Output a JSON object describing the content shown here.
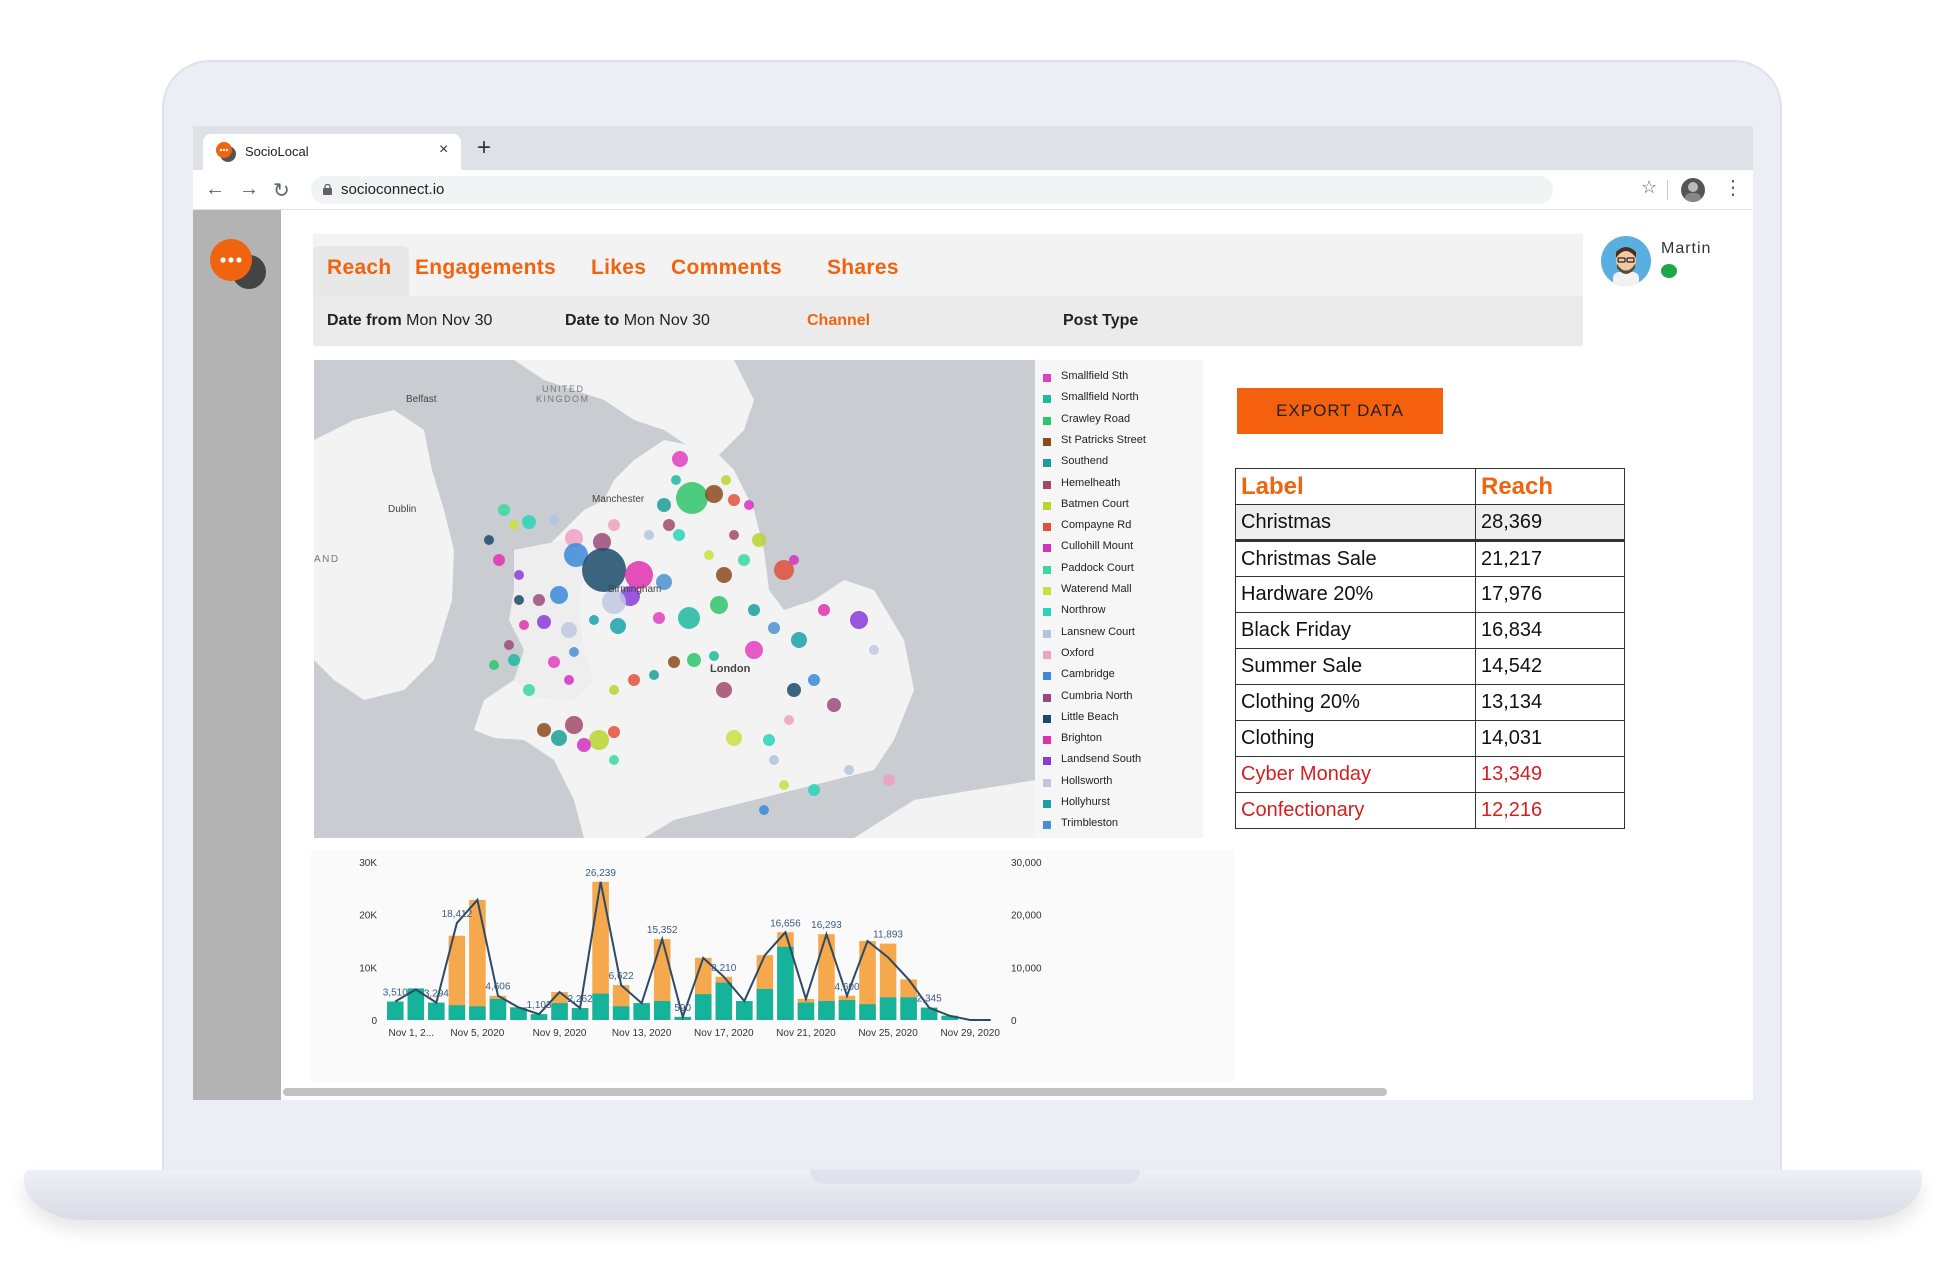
{
  "browser": {
    "tab_title": "SocioLocal",
    "tab_close": "×",
    "new_tab": "+",
    "url": "socioconnect.io",
    "nav_back": "←",
    "nav_forward": "→",
    "nav_reload": "↻",
    "star": "☆",
    "menu": "⋮"
  },
  "user": {
    "name": "Martin",
    "status_color": "#1fa64a"
  },
  "tabs": [
    {
      "label": "Reach",
      "active": true
    },
    {
      "label": "Engagements"
    },
    {
      "label": "Likes"
    },
    {
      "label": "Comments"
    },
    {
      "label": "Shares"
    }
  ],
  "filters": {
    "date_from_label": "Date from",
    "date_from_value": "Mon Nov 30",
    "date_to_label": "Date to",
    "date_to_value": "Mon Nov 30",
    "channel": "Channel",
    "post_type": "Post Type"
  },
  "map": {
    "labels": [
      "Belfast",
      "UNITED",
      "KINGDOM",
      "Dublin",
      "Manchester",
      "Birmingham",
      "London",
      "AND"
    ]
  },
  "legend": [
    {
      "label": "Smallfield Sth",
      "color": "#e040c0"
    },
    {
      "label": "Smallfield North",
      "color": "#1fb8a0"
    },
    {
      "label": "Crawley Road",
      "color": "#2fc46a"
    },
    {
      "label": "St Patricks Street",
      "color": "#8b4a1c"
    },
    {
      "label": "Southend",
      "color": "#1a9e9a"
    },
    {
      "label": "Hemelheath",
      "color": "#a04a6a"
    },
    {
      "label": "Batmen Court",
      "color": "#b8d430"
    },
    {
      "label": "Compayne Rd",
      "color": "#e0503a"
    },
    {
      "label": "Cullohill Mount",
      "color": "#d430c0"
    },
    {
      "label": "Paddock Court",
      "color": "#3ad8a0"
    },
    {
      "label": "Waterend Mall",
      "color": "#c8e040"
    },
    {
      "label": "Northrow",
      "color": "#2ad4b8"
    },
    {
      "label": "Lansnew Court",
      "color": "#b0c4e0"
    },
    {
      "label": "Oxford",
      "color": "#f0a0c0"
    },
    {
      "label": "Cambridge",
      "color": "#3a8ad8"
    },
    {
      "label": "Cumbria North",
      "color": "#9a4a7a"
    },
    {
      "label": "Little Beach",
      "color": "#1a4a6a"
    },
    {
      "label": "Brighton",
      "color": "#e030b0"
    },
    {
      "label": "Landsend South",
      "color": "#8a3ad8"
    },
    {
      "label": "Hollsworth",
      "color": "#c0c8e0"
    },
    {
      "label": "Hollyhurst",
      "color": "#1aa0a8"
    },
    {
      "label": "Trimbleston",
      "color": "#4a90d0"
    }
  ],
  "export_label": "EXPORT DATA",
  "table": {
    "headers": [
      "Label",
      "Reach"
    ],
    "rows": [
      {
        "label": "Christmas",
        "reach": "28,369"
      },
      {
        "label": "Christmas Sale",
        "reach": "21,217"
      },
      {
        "label": "Hardware 20%",
        "reach": "17,976"
      },
      {
        "label": "Black Friday",
        "reach": "16,834"
      },
      {
        "label": "Summer Sale",
        "reach": "14,542"
      },
      {
        "label": "Clothing 20%",
        "reach": "13,134"
      },
      {
        "label": "Clothing",
        "reach": "14,031"
      },
      {
        "label": "Cyber Monday",
        "reach": "13,349"
      },
      {
        "label": "Confectionary",
        "reach": "12,216"
      }
    ]
  },
  "colors": {
    "accent": "#f0640f",
    "bar_orange": "#f5a84c",
    "bar_teal": "#14b39a",
    "line": "#2d4a66"
  },
  "chart_data": {
    "type": "bar",
    "x_tick_labels": [
      "Nov 1, 2...",
      "Nov 5, 2020",
      "Nov 9, 2020",
      "Nov 13, 2020",
      "Nov 17, 2020",
      "Nov 21, 2020",
      "Nov 25, 2020",
      "Nov 29, 2020"
    ],
    "y_left_ticks": [
      "0",
      "10K",
      "20K",
      "30K"
    ],
    "y_right_ticks": [
      "0",
      "10,000",
      "20,000",
      "30,000"
    ],
    "ylim": [
      0,
      30000
    ],
    "categories": [
      "1",
      "2",
      "3",
      "4",
      "5",
      "6",
      "7",
      "8",
      "9",
      "10",
      "11",
      "12",
      "13",
      "14",
      "15",
      "16",
      "17",
      "18",
      "19",
      "20",
      "21",
      "22",
      "23",
      "24",
      "25",
      "26",
      "27",
      "28",
      "29",
      "30"
    ],
    "series": [
      {
        "values": [
          3510,
          5800,
          3294,
          16000,
          22800,
          4606,
          2400,
          1103,
          5300,
          2262,
          26239,
          6622,
          3200,
          15352,
          590,
          11800,
          8210,
          3600,
          12300,
          16656,
          4000,
          16293,
          4600,
          15000,
          14500,
          7700,
          2345,
          800,
          0,
          0
        ]
      },
      {
        "values": [
          3510,
          6000,
          3294,
          2800,
          2600,
          4000,
          2400,
          1103,
          3200,
          2262,
          5000,
          2600,
          3200,
          3600,
          590,
          4900,
          7100,
          3600,
          5900,
          13900,
          3300,
          3600,
          3800,
          3000,
          4300,
          4300,
          2345,
          800,
          0,
          0
        ]
      }
    ],
    "line_values": [
      3510,
      5800,
      3294,
      18412,
      22800,
      4606,
      2400,
      1103,
      5300,
      2262,
      26239,
      6622,
      3200,
      15352,
      590,
      11800,
      8210,
      3600,
      12300,
      16656,
      4000,
      16293,
      4600,
      15000,
      11893,
      7700,
      2345,
      800,
      0,
      0
    ],
    "data_labels": [
      {
        "i": 0,
        "text": "3,510"
      },
      {
        "i": 2,
        "text": "3,294"
      },
      {
        "i": 3,
        "text": "18,412"
      },
      {
        "i": 5,
        "text": "4,606"
      },
      {
        "i": 7,
        "text": "1,103"
      },
      {
        "i": 9,
        "text": "2,262"
      },
      {
        "i": 10,
        "text": "26,239"
      },
      {
        "i": 11,
        "text": "6,622"
      },
      {
        "i": 13,
        "text": "15,352"
      },
      {
        "i": 14,
        "text": "590"
      },
      {
        "i": 16,
        "text": "8,210"
      },
      {
        "i": 19,
        "text": "16,656"
      },
      {
        "i": 21,
        "text": "16,293"
      },
      {
        "i": 22,
        "text": "4,600"
      },
      {
        "i": 24,
        "text": "11,893"
      },
      {
        "i": 26,
        "text": "2,345"
      }
    ]
  }
}
